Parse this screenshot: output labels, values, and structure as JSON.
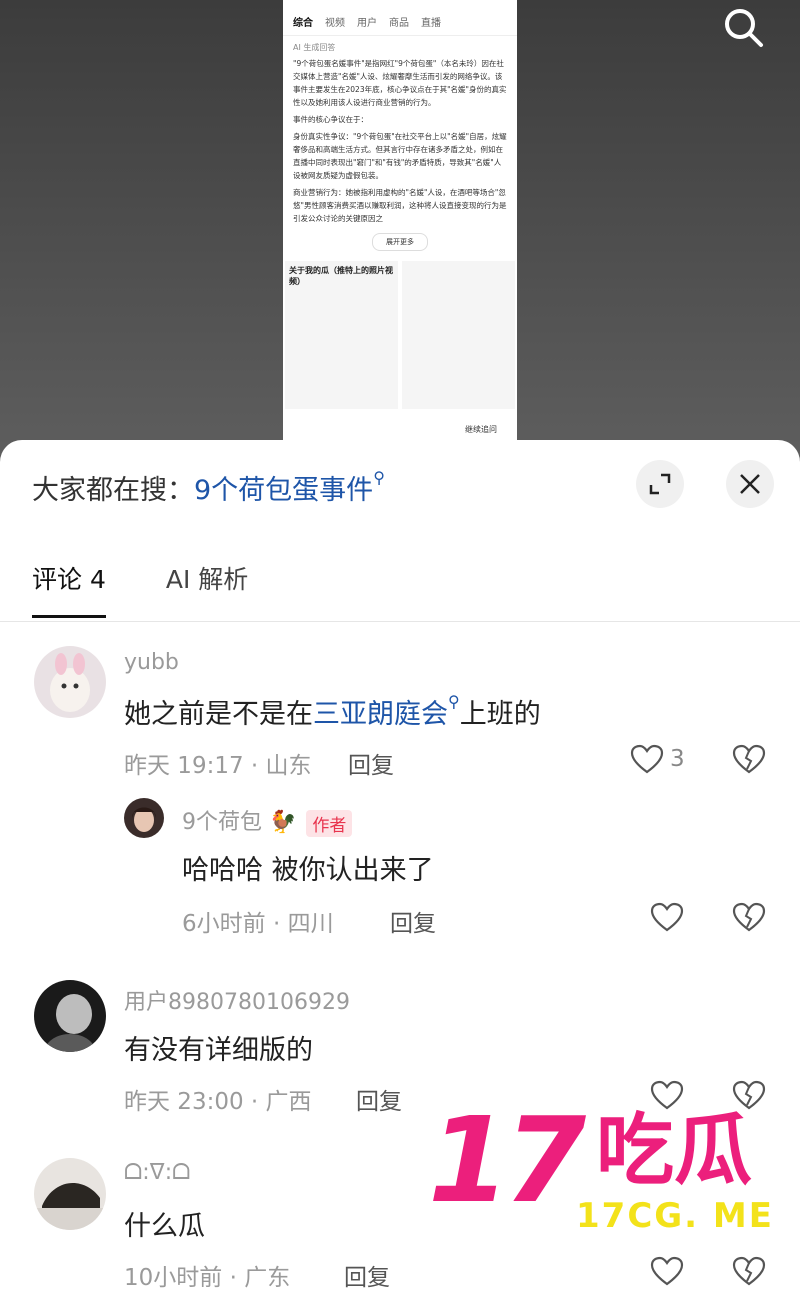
{
  "video": {
    "tabs": [
      "综合",
      "视频",
      "用户",
      "商品",
      "直播"
    ],
    "ai_label": "AI 生成回答",
    "paragraph1": "\"9个荷包蛋名媛事件\"是指网红\"9个荷包蛋\"（本名未玲）因在社交媒体上营造\"名媛\"人设、炫耀奢靡生活而引发的网络争议。该事件主要发生在2023年底，核心争议点在于其\"名媛\"身份的真实性以及她利用该人设进行商业营销的行为。",
    "paragraph2": "事件的核心争议在于：",
    "bullet1": "身份真实性争议：\"9个荷包蛋\"在社交平台上以\"名媛\"自居，炫耀奢侈品和高端生活方式。但其言行中存在诸多矛盾之处，例如在直播中同时表现出\"窘门\"和\"有钱\"的矛盾特质，导致其\"名媛\"人设被网友质疑为虚假包装。",
    "bullet2": "商业营销行为：她被指利用虚构的\"名媛\"人设，在酒吧等场合\"忽悠\"男性顾客消费买酒以赚取利润，这种将人设直接变现的行为是引发公众讨论的关键原因之",
    "more_label": "展开更多",
    "card_title": "关于我的瓜（推特上的照片视频）",
    "follow_label": "继续追问"
  },
  "sheet": {
    "hot_search_prefix": "大家都在搜：",
    "hot_search_keyword": "9个荷包蛋事件",
    "tabs": {
      "comments": "评论 4",
      "ai": "AI 解析"
    }
  },
  "comments": [
    {
      "user": "yubb",
      "text_before": "她之前是不是在",
      "text_link": "三亚朗庭会",
      "text_after": "上班的",
      "meta": "昨天 19:17 · 山东",
      "reply_label": "回复",
      "likes": "3",
      "reply": {
        "user": "9个荷包",
        "badge": "作者",
        "text": "哈哈哈 被你认出来了",
        "meta": "6小时前 · 四川",
        "reply_label": "回复"
      }
    },
    {
      "user": "用户8980780106929",
      "text": "有没有详细版的",
      "meta": "昨天 23:00 · 广西",
      "reply_label": "回复"
    },
    {
      "user": "ᗝ:ᐁ:ᗝ",
      "text": "什么瓜",
      "meta": "10小时前 · 广东",
      "reply_label": "回复"
    }
  ],
  "watermark": {
    "number": "17",
    "cn": "吃瓜",
    "url": "17CG. ME"
  },
  "colors": {
    "link": "#1e55a8",
    "author_badge": "#e8344e",
    "watermark_pink": "#ec1f7c",
    "watermark_yellow": "#f3e21a"
  }
}
